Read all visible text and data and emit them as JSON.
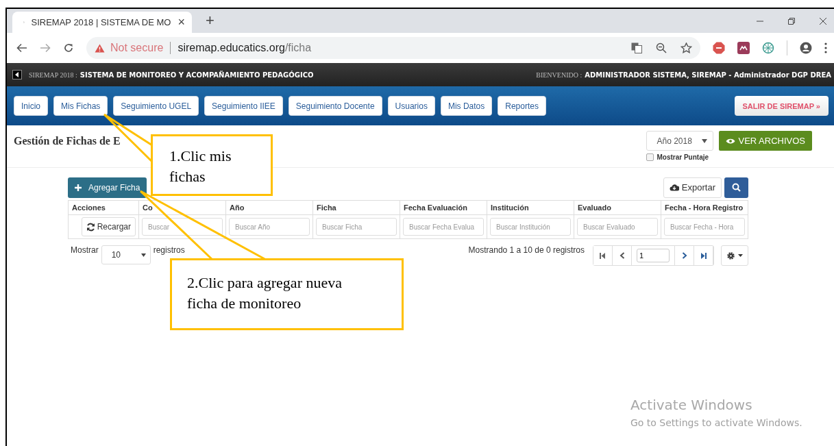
{
  "browser": {
    "tab": {
      "title": "SIREMAP 2018 | SISTEMA DE MO",
      "close": "×"
    },
    "new_tab": "+",
    "address": {
      "warning": "Not secure",
      "host": "siremap.educatics.org",
      "path": "/ficha"
    }
  },
  "header": {
    "app": "SIREMAP 2018 :",
    "title": "SISTEMA DE MONITOREO Y ACOMPAÑAMIENTO PEDAGÓGICO",
    "greeting": "BIENVENIDO :",
    "user": "ADMINISTRADOR SISTEMA, SIREMAP - Administrador DGP DREA"
  },
  "nav": {
    "items": [
      {
        "label": "Inicio"
      },
      {
        "label": "Mis Fichas"
      },
      {
        "label": "Seguimiento UGEL"
      },
      {
        "label": "Seguimiento IIEE"
      },
      {
        "label": "Seguimiento Docente"
      },
      {
        "label": "Usuarios"
      },
      {
        "label": "Mis Datos"
      },
      {
        "label": "Reportes"
      }
    ],
    "logout": "SALIR DE SIREMAP »"
  },
  "page": {
    "heading": "Gestión de Fichas de E",
    "year_select": "Año 2018",
    "view_files": "VER ARCHIVOS",
    "show_score": {
      "label": "Mostrar Puntaje",
      "checked": false
    }
  },
  "toolbar": {
    "add": "Agregar Ficha",
    "export": "Exportar"
  },
  "table": {
    "columns": [
      "Acciones",
      "Co",
      "Año",
      "Ficha",
      "Fecha Evaluación",
      "Institución",
      "Evaluado",
      "Fecha - Hora Registro"
    ],
    "reload": "Recargar",
    "filters": [
      {
        "placeholder": "Buscar"
      },
      {
        "placeholder": "Buscar Año"
      },
      {
        "placeholder": "Buscar Ficha"
      },
      {
        "placeholder": "Buscar Fecha Evalua"
      },
      {
        "placeholder": "Buscar Institución"
      },
      {
        "placeholder": "Buscar Evaluado"
      },
      {
        "placeholder": "Buscar Fecha - Hora"
      }
    ]
  },
  "footer": {
    "show": "Mostrar",
    "page_size": "10",
    "records": "registros",
    "summary": "Mostrando 1 a 10 de 0 registros",
    "page": "1"
  },
  "callouts": [
    {
      "text": "1.Clic mis fichas"
    },
    {
      "text": "2.Clic para agregar nueva ficha de monitoreo"
    }
  ],
  "watermark": {
    "title": "Activate Windows",
    "text": "Go to Settings to activate Windows."
  }
}
